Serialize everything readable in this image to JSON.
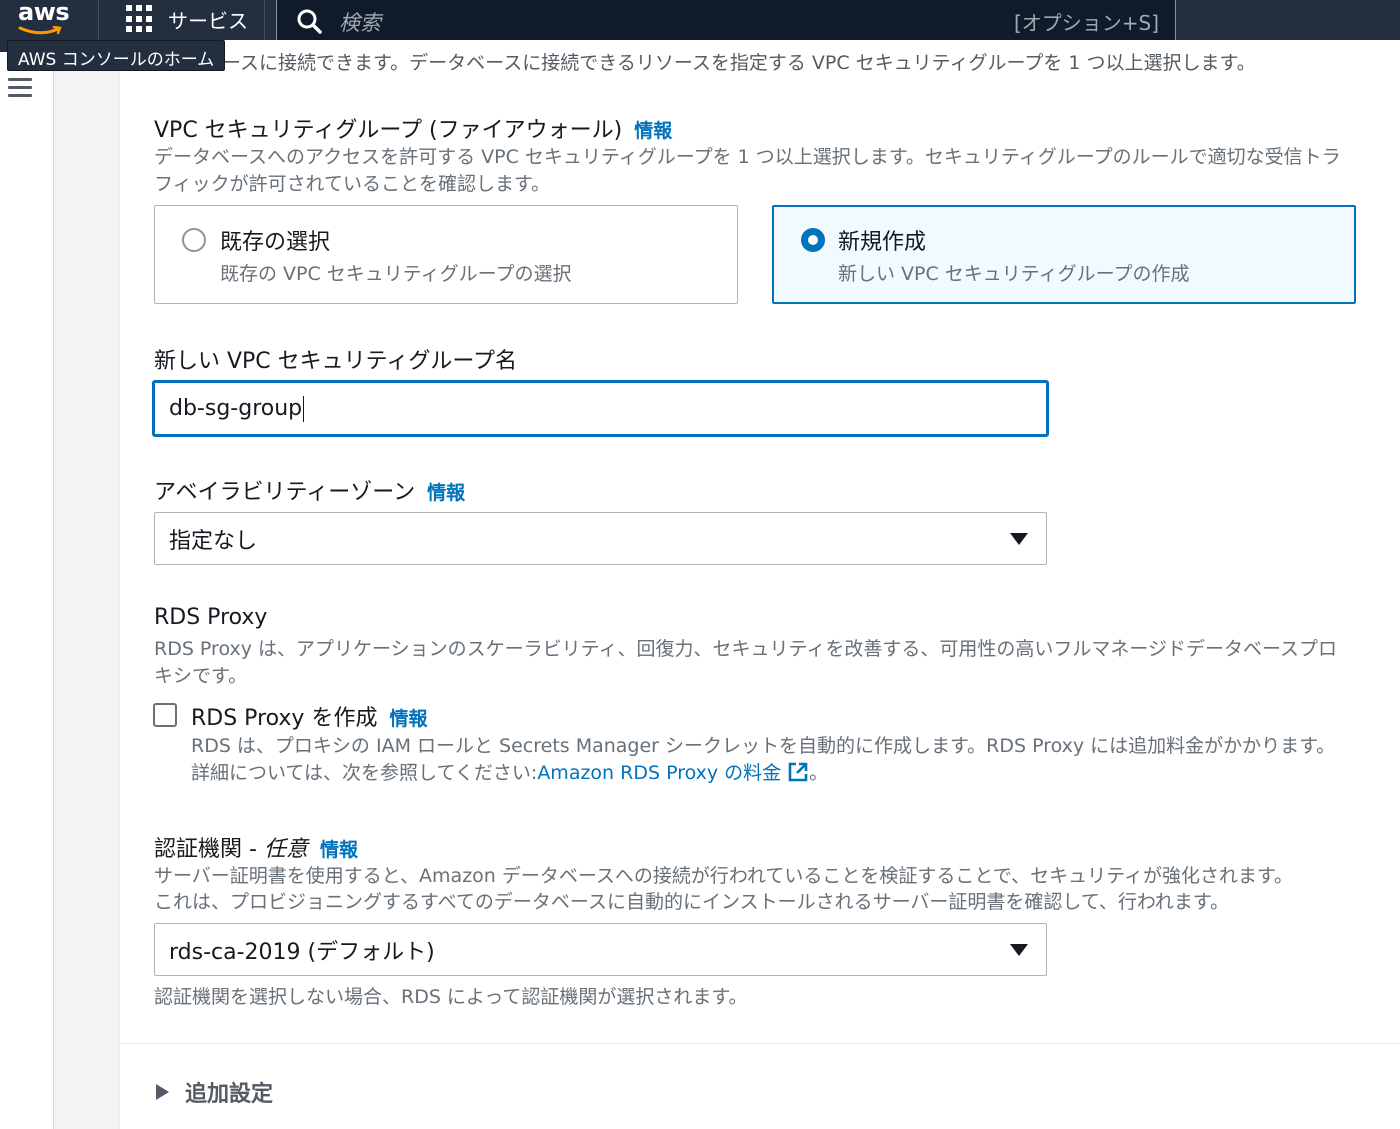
{
  "nav": {
    "logo_text": "aws",
    "services_label": "サービス",
    "search_placeholder": "検索",
    "search_shortcut": "[オプション+S]",
    "tooltip": "AWS コンソールのホーム"
  },
  "intro_truncated": "ースに接続できます。データベースに接続できるリソースを指定する VPC セキュリティグループを 1 つ以上選択します。",
  "vpc_sg": {
    "label": "VPC セキュリティグループ (ファイアウォール)",
    "info": "情報",
    "description": "データベースへのアクセスを許可する VPC セキュリティグループを 1 つ以上選択します。セキュリティグループのルールで適切な受信トラフィックが許可されていることを確認します。",
    "options": [
      {
        "title": "既存の選択",
        "subtitle": "既存の VPC セキュリティグループの選択",
        "selected": false
      },
      {
        "title": "新規作成",
        "subtitle": "新しい VPC セキュリティグループの作成",
        "selected": true
      }
    ]
  },
  "new_sg_name": {
    "label": "新しい VPC セキュリティグループ名",
    "value": "db-sg-group"
  },
  "az": {
    "label": "アベイラビリティーゾーン",
    "info": "情報",
    "value": "指定なし"
  },
  "rds_proxy": {
    "heading": "RDS Proxy",
    "description": "RDS Proxy は、アプリケーションのスケーラビリティ、回復力、セキュリティを改善する、可用性の高いフルマネージドデータベースプロキシです。",
    "checkbox_label": "RDS Proxy を作成",
    "info": "情報",
    "checked": false,
    "help_line1": "RDS は、プロキシの IAM ロールと Secrets Manager シークレットを自動的に作成します。RDS Proxy には追加料金がかかります。",
    "help_line2_prefix": "詳細については、次を参照してください:",
    "help_link": "Amazon RDS Proxy の料金",
    "help_suffix": "。"
  },
  "ca": {
    "label_main": "認証機関 - ",
    "label_optional": "任意",
    "info": "情報",
    "description_line1": "サーバー証明書を使用すると、Amazon データベースへの接続が行われていることを検証することで、セキュリティが強化されます。",
    "description_line2": "これは、プロビジョニングするすべてのデータベースに自動的にインストールされるサーバー証明書を確認して、行われます。",
    "value": "rds-ca-2019 (デフォルト)",
    "hint": "認証機関を選択しない場合、RDS によって認証機関が選択されます。"
  },
  "additional": {
    "label": "追加設定"
  },
  "colors": {
    "accent": "#0073bb",
    "nav_bg": "#232f3e",
    "aws_orange": "#ff9900"
  }
}
